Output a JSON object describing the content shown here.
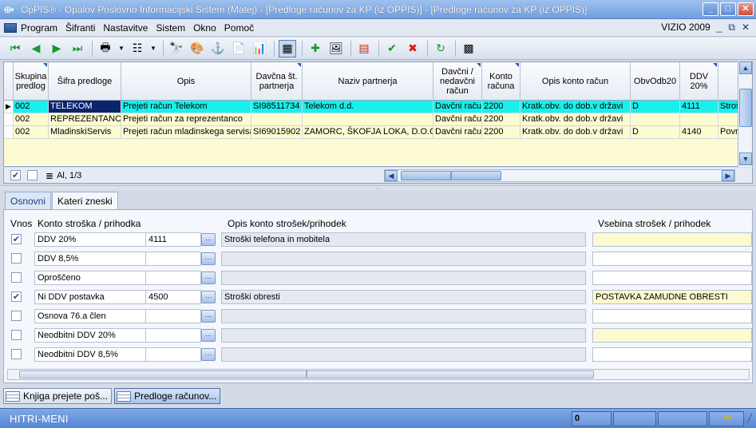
{
  "window": {
    "title": "OpPIS® - Opalov Poslovno Informacijski Sistem  (Matej) - [Predloge računov za KP (iz OPPIS)] - [Predloge računov za KP (iz OPPIS)]"
  },
  "menu": {
    "items": [
      "Program",
      "Šifranti",
      "Nastavitve",
      "Sistem",
      "Okno",
      "Pomoč"
    ],
    "right_label": "VIZIO 2009"
  },
  "grid": {
    "columns": [
      "Skupina predlog",
      "Šifra predloge",
      "Opis",
      "Davčna št. partnerja",
      "Naziv partnerja",
      "Davčni / nedavčni račun",
      "Konto računa",
      "Opis konto račun",
      "ObvOdb20",
      "DDV 20%",
      ""
    ],
    "rows": [
      [
        "002",
        "TELEKOM",
        "Prejeti račun Telekom",
        "SI98511734",
        "Telekom d.d.",
        "Davčni račun",
        "2200",
        "Kratk.obv. do dob.v državi",
        "D",
        "4111",
        "Stroš"
      ],
      [
        "002",
        "REPREZENTANCA",
        "Prejeti račun za reprezentanco",
        "",
        "",
        "Davčni račun",
        "2200",
        "Kratk.obv. do dob.v državi",
        "",
        "",
        ""
      ],
      [
        "002",
        "MladinskiServis",
        "Prejeti račun mladinskega servisa",
        "SI69015902",
        "ZAMORC, ŠKOFJA LOKA, D.O.O.",
        "Davčni račun",
        "2200",
        "Kratk.obv. do dob.v državi",
        "D",
        "4140",
        "Povr"
      ]
    ],
    "status_text": "Al, 1/3"
  },
  "tabs": [
    "Osnovni",
    "Kateri zneski"
  ],
  "detail": {
    "headers": {
      "vnos": "Vnos",
      "konto": "Konto stroška / prihodka",
      "opis": "Opis konto strošek/prihodek",
      "vsebina": "Vsebina strošek / prihodek"
    },
    "rows": [
      {
        "checked": true,
        "name": "DDV 20%",
        "code": "4111",
        "desc": "Stroški telefona in mobitela",
        "vsebina": "",
        "yellow": true
      },
      {
        "checked": false,
        "name": "DDV 8,5%",
        "code": "",
        "desc": "",
        "vsebina": "",
        "yellow": false
      },
      {
        "checked": false,
        "name": "Oproščeno",
        "code": "",
        "desc": "",
        "vsebina": "",
        "yellow": false
      },
      {
        "checked": true,
        "name": "Ni DDV postavka",
        "code": "4500",
        "desc": "Stroški obresti",
        "vsebina": "POSTAVKA ZAMUDNE OBRESTI",
        "yellow": true
      },
      {
        "checked": false,
        "name": "Osnova 76.a člen",
        "code": "",
        "desc": "",
        "vsebina": "",
        "yellow": false
      },
      {
        "checked": false,
        "name": "Neodbitni DDV 20%",
        "code": "",
        "desc": "",
        "vsebina": "",
        "yellow": true
      },
      {
        "checked": false,
        "name": "Neodbitni DDV 8,5%",
        "code": "",
        "desc": "",
        "vsebina": "",
        "yellow": false
      }
    ]
  },
  "window_tabs": [
    "Knjiga prejete poš...",
    "Predloge računov..."
  ],
  "status": {
    "label": "HITRI-MENI",
    "count": "0"
  }
}
